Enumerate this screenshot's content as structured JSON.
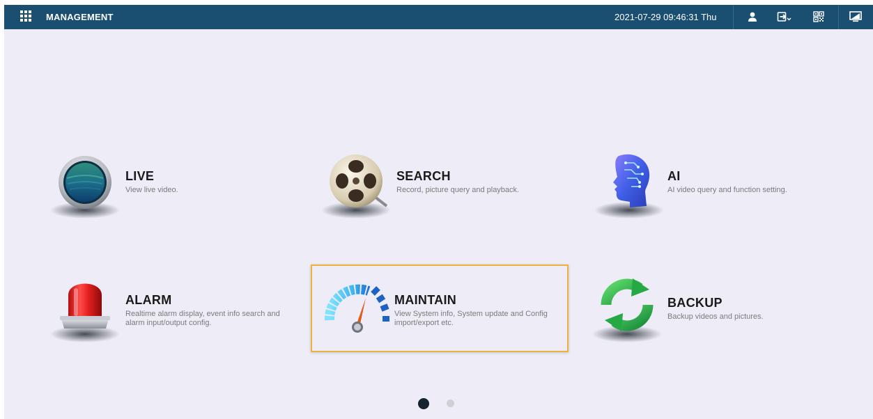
{
  "topbar": {
    "title": "MANAGEMENT",
    "datetime": "2021-07-29 09:46:31 Thu",
    "icons": [
      "menu-grid-icon",
      "user-icon",
      "logout-icon",
      "qr-code-icon",
      "desktop-icon"
    ]
  },
  "tiles": [
    {
      "title": "LIVE",
      "desc": "View live video.",
      "icon": "live-camera-icon"
    },
    {
      "title": "SEARCH",
      "desc": "Record, picture query and playback.",
      "icon": "film-reel-icon"
    },
    {
      "title": "AI",
      "desc": "AI video query and function setting.",
      "icon": "ai-head-icon"
    },
    {
      "title": "ALARM",
      "desc": "Realtime alarm display, event info search and alarm input/output config.",
      "icon": "alarm-light-icon"
    },
    {
      "title": "MAINTAIN",
      "desc": "View System info, System update and Config import/export etc.",
      "icon": "speedometer-icon",
      "selected": true
    },
    {
      "title": "BACKUP",
      "desc": "Backup videos and pictures.",
      "icon": "refresh-arrows-icon"
    }
  ],
  "pager": {
    "pages": 2,
    "current": 1
  },
  "colors": {
    "topbar": "#1b4f72",
    "background": "#eeedf7",
    "selection": "#f0b03c"
  }
}
